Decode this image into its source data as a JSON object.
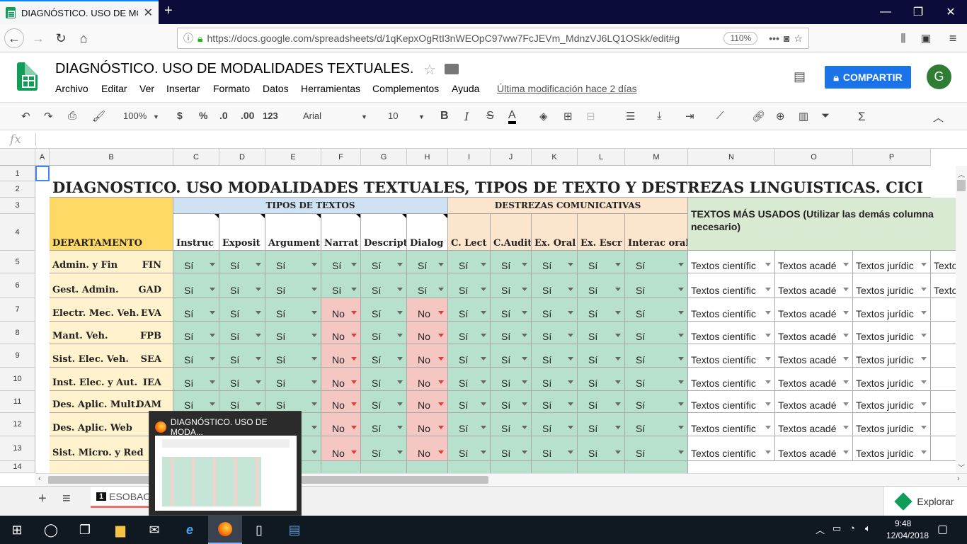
{
  "browser": {
    "tab_title": "DIAGNÓSTICO. USO DE MODA",
    "url": "https://docs.google.com/spreadsheets/d/1qKepxOgRtI3nWEOpC97ww7FcJEVm_MdnzVJ6LQ1OSkk/edit#g",
    "zoom": "110%"
  },
  "doc": {
    "title": "DIAGNÓSTICO. USO DE MODALIDADES TEXTUALES.",
    "menus": [
      "Archivo",
      "Editar",
      "Ver",
      "Insertar",
      "Formato",
      "Datos",
      "Herramientas",
      "Complementos",
      "Ayuda"
    ],
    "last_modified": "Última modificación hace 2 días",
    "share_label": "COMPARTIR",
    "avatar_letter": "G"
  },
  "toolbar": {
    "zoom": "100%",
    "currency": "$",
    "percent": "%",
    "dec_less": ".0",
    "dec_more": ".00",
    "format": "123",
    "font": "Arial",
    "size": "10"
  },
  "formula": {
    "fx": "fx"
  },
  "grid": {
    "columns": [
      "A",
      "B",
      "C",
      "D",
      "E",
      "F",
      "G",
      "H",
      "I",
      "J",
      "K",
      "L",
      "M",
      "N",
      "O",
      "P"
    ],
    "rows": [
      "1",
      "2",
      "3",
      "4",
      "5",
      "6",
      "7",
      "8",
      "9",
      "10",
      "11",
      "12",
      "13",
      "14"
    ],
    "title": "DIAGNÓSTICO. USO MODALIDADES TEXTUALES, TIPOS DE TEXTO Y DESTREZAS LINGÜÍSTICAS. CICI",
    "group_tipos": "TIPOS DE TEXTOS",
    "group_destrezas": "DESTREZAS COMUNICATIVAS",
    "group_textos": "TEXTOS MÁS USADOS   (Utilizar las demás columna necesario)",
    "dept_header": "DEPARTAMENTO",
    "headers": [
      "Instruc",
      "Exposit",
      "Argument",
      "Narrat",
      "Descript",
      "Dialog",
      "C. Lect",
      "C.Audit",
      "Ex. Oral",
      "Ex. Escr",
      "Interac oral"
    ],
    "departments": [
      {
        "name": "Admin. y Fin",
        "code": "FIN",
        "vals": [
          "Sí",
          "Sí",
          "Sí",
          "Sí",
          "Sí",
          "Sí",
          "Sí",
          "Sí",
          "Sí",
          "Sí",
          "Sí"
        ],
        "texts": [
          "Textos científic",
          "Textos acadé",
          "Textos jurídic",
          "Texto"
        ]
      },
      {
        "name": "Gest. Admin.",
        "code": "GAD",
        "vals": [
          "Sí",
          "Sí",
          "Sí",
          "Sí",
          "Sí",
          "Sí",
          "Sí",
          "Sí",
          "Sí",
          "Sí",
          "Sí"
        ],
        "texts": [
          "Textos científic",
          "Textos acadé",
          "Textos jurídic",
          "Texto"
        ]
      },
      {
        "name": "Electr. Mec. Veh.",
        "code": "EVA",
        "vals": [
          "Sí",
          "Sí",
          "Sí",
          "No",
          "Sí",
          "No",
          "Sí",
          "Sí",
          "Sí",
          "Sí",
          "Sí"
        ],
        "texts": [
          "Textos científic",
          "Textos acadé",
          "Textos jurídic",
          ""
        ]
      },
      {
        "name": "Mant. Veh.",
        "code": "FPB",
        "vals": [
          "Sí",
          "Sí",
          "Sí",
          "No",
          "Sí",
          "No",
          "Sí",
          "Sí",
          "Sí",
          "Sí",
          "Sí"
        ],
        "texts": [
          "Textos científic",
          "Textos acadé",
          "Textos jurídic",
          ""
        ]
      },
      {
        "name": "Sist. Elec. Veh.",
        "code": "SEA",
        "vals": [
          "Sí",
          "Sí",
          "Sí",
          "No",
          "Sí",
          "No",
          "Sí",
          "Sí",
          "Sí",
          "Sí",
          "Sí"
        ],
        "texts": [
          "Textos científic",
          "Textos acadé",
          "Textos jurídic",
          ""
        ]
      },
      {
        "name": "Inst. Elec. y Aut.",
        "code": "IEA",
        "vals": [
          "Sí",
          "Sí",
          "Sí",
          "No",
          "Sí",
          "No",
          "Sí",
          "Sí",
          "Sí",
          "Sí",
          "Sí"
        ],
        "texts": [
          "Textos científic",
          "Textos acadé",
          "Textos jurídic",
          ""
        ]
      },
      {
        "name": "Des. Aplic. Mult.",
        "code": "DAM",
        "vals": [
          "Sí",
          "Sí",
          "Sí",
          "No",
          "Sí",
          "No",
          "Sí",
          "Sí",
          "Sí",
          "Sí",
          "Sí"
        ],
        "texts": [
          "Textos científic",
          "Textos acadé",
          "Textos jurídic",
          ""
        ]
      },
      {
        "name": "Des. Aplic. Web",
        "code": "D",
        "vals": [
          "Sí",
          "Sí",
          "Sí",
          "No",
          "Sí",
          "No",
          "Sí",
          "Sí",
          "Sí",
          "Sí",
          "Sí"
        ],
        "texts": [
          "Textos científic",
          "Textos acadé",
          "Textos jurídic",
          ""
        ]
      },
      {
        "name": "Sist. Micro. y Red",
        "code": "S",
        "vals": [
          "Sí",
          "Sí",
          "Sí",
          "No",
          "Sí",
          "No",
          "Sí",
          "Sí",
          "Sí",
          "Sí",
          "Sí"
        ],
        "texts": [
          "Textos científic",
          "Textos acadé",
          "Textos jurídic",
          ""
        ]
      }
    ]
  },
  "sheets": {
    "tab_num": "1",
    "tab_label": "ESOBAC",
    "explore": "Explorar"
  },
  "preview": {
    "title": "DIAGNÓSTICO. USO DE MODA..."
  },
  "clock": {
    "time": "9:48",
    "date": "12/04/2018"
  },
  "colors": {
    "sheets_green": "#0f9d58",
    "share_blue": "#1a73e8",
    "yes_green": "#b7e1cd",
    "no_red": "#f4c7c3",
    "tipos_hdr": "#cfe2f3",
    "destrezas_hdr": "#fce5cd",
    "dept_yellow": "#ffd966",
    "dept_light": "#fff2cc",
    "textos_green": "#d9ead3"
  }
}
